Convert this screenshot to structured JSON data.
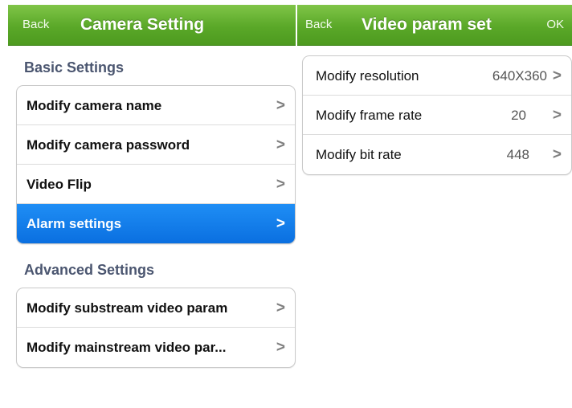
{
  "left_screen": {
    "navbar": {
      "back_label": "Back",
      "title": "Camera Setting"
    },
    "basic_section": {
      "header": "Basic Settings",
      "items": [
        {
          "label": "Modify camera name",
          "chevron": ">"
        },
        {
          "label": "Modify camera password",
          "chevron": ">"
        },
        {
          "label": "Video Flip",
          "chevron": ">"
        },
        {
          "label": "Alarm settings",
          "chevron": ">",
          "selected": true
        }
      ]
    },
    "advanced_section": {
      "header": "Advanced Settings",
      "items": [
        {
          "label": "Modify substream video param",
          "chevron": ">"
        },
        {
          "label": "Modify mainstream video par...",
          "chevron": ">"
        }
      ]
    }
  },
  "right_screen": {
    "navbar": {
      "back_label": "Back",
      "title": "Video param set",
      "ok_label": "OK"
    },
    "items": [
      {
        "label": "Modify resolution",
        "value": "640X360",
        "chevron": ">"
      },
      {
        "label": "Modify frame rate",
        "value": "20",
        "chevron": ">"
      },
      {
        "label": "Modify bit rate",
        "value": "448",
        "chevron": ">"
      }
    ]
  },
  "colors": {
    "navbar_green": "#5aa828",
    "selection_blue": "#0a6fe0",
    "section_header": "#4b5670"
  }
}
